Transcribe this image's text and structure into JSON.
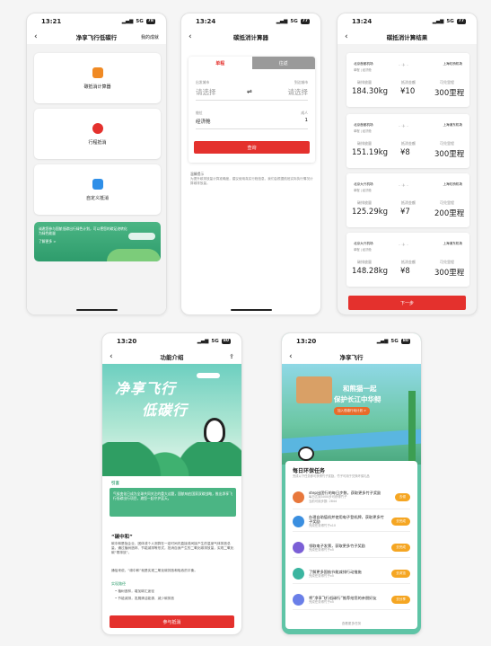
{
  "screen1": {
    "time": "13:21",
    "signal": "5G",
    "battery": "78",
    "title": "净享飞行低碳行",
    "right_link": "我的成就",
    "cards": [
      "碳抵消计算器",
      "行程抵消",
      "自定义抵消"
    ],
    "banner_text": "诚邀您参与国航低碳出行绿色计划，可以把您的碳足迹转化为绿色能量",
    "banner_link": "了解更多 >"
  },
  "screen2": {
    "time": "13:24",
    "signal": "5G",
    "battery": "77",
    "title": "碳抵消计算器",
    "tabs": [
      "单程",
      "往返"
    ],
    "depart_label": "出发城市",
    "arrive_label": "到达城市",
    "depart_placeholder": "请选择",
    "arrive_placeholder": "请选择",
    "swap_icon": "⇌",
    "cabin_label": "舱位",
    "cabin_value": "经济舱",
    "adult_label": "成人",
    "adult_value": "1",
    "query_button": "查询",
    "tip_title": "温馨提示",
    "tip_text": "为提升碳排放量计算准确度，建议使用真实行程信息，我们会根据航班实际执行情况计算碳排放量。"
  },
  "screen3": {
    "time": "13:24",
    "signal": "5G",
    "battery": "77",
    "title": "碳抵消计算结果",
    "col_labels": [
      "碳排放量",
      "抵消金额",
      "可兑里程"
    ],
    "results": [
      {
        "from": "北京首都机场",
        "from_cabin": "单程 | 经济舱",
        "to": "上海虹桥机场",
        "carbon": "184.30kg",
        "amount": "¥10",
        "miles": "300里程"
      },
      {
        "from": "北京首都机场",
        "from_cabin": "单程 | 经济舱",
        "to": "上海浦东机场",
        "carbon": "151.19kg",
        "amount": "¥8",
        "miles": "300里程"
      },
      {
        "from": "北京大兴机场",
        "from_cabin": "单程 | 经济舱",
        "to": "上海虹桥机场",
        "carbon": "125.29kg",
        "amount": "¥7",
        "miles": "200里程"
      },
      {
        "from": "北京大兴机场",
        "from_cabin": "单程 | 经济舱",
        "to": "上海浦东机场",
        "carbon": "148.28kg",
        "amount": "¥8",
        "miles": "300里程"
      }
    ],
    "next_button": "下一步"
  },
  "screen4": {
    "time": "13:20",
    "signal": "5G",
    "battery": "80",
    "title": "功能介绍",
    "hero_line1": "净享飞行",
    "hero_line2": "低碳行",
    "intro_heading": "引言",
    "intro_text": "气候变化已成为全球共同关注的重大议题，国航响应国家双碳战略，推出净享飞行低碳出行项目，邀您一起守护蓝天。",
    "section_heading": "“碳中和”",
    "section_text": "碳中和是指企业、团体或个人测算在一定时间内直接或间接产生的温室气体排放总量，通过植树造林、节能减排等形式，抵消自身产生的二氧化碳排放量，实现二氧化碳“零排放”。",
    "section_text2": "通俗来说，“碳中和”就是实现二氧化碳排放和吸收的平衡。",
    "methods_heading": "实现路径",
    "methods": [
      "植树造林，增加碳汇途径",
      "节能减排，发展清洁能源、减少碳排放"
    ],
    "cta_button": "参与抵消"
  },
  "screen5": {
    "time": "13:20",
    "signal": "5G",
    "battery": "80",
    "title": "净享飞行",
    "hero_title": "和熊猫一起",
    "hero_sub": "保护长江中华鲟",
    "hero_button": "加入低碳行动计划 >",
    "tasks_title": "每日环保任务",
    "tasks_desc": "完成以下任务即可获得竹子奖励，竹子可用于兑换环保礼品",
    "tasks": [
      {
        "title": "step出团行的每日步数，获取更多竹子奖励",
        "sub": "每日达到3000步可获得竹子",
        "sub2": "当前可用步数: 2844",
        "button": "去领"
      },
      {
        "title": "办理自助值机并使用电子登机牌，获取更多竹子奖励",
        "sub": "完成任务得竹子x10",
        "button": "去完成"
      },
      {
        "title": "领取电子发票，获取更多竹子奖励",
        "sub": "完成任务得竹子x5",
        "button": "去完成"
      },
      {
        "title": "了解更多国航节能减排行动措施",
        "sub": "完成任务得竹子x5",
        "button": "去浏览"
      },
      {
        "title": "将“净享飞行低碳行”推荐给您的亲朋好友",
        "sub": "完成任务得竹子x5",
        "button": "去分享"
      }
    ],
    "more_link": "查看更多任务"
  },
  "colors": {
    "brand_red": "#e4312d",
    "green": "#4bb584",
    "orange": "#f5a623"
  }
}
